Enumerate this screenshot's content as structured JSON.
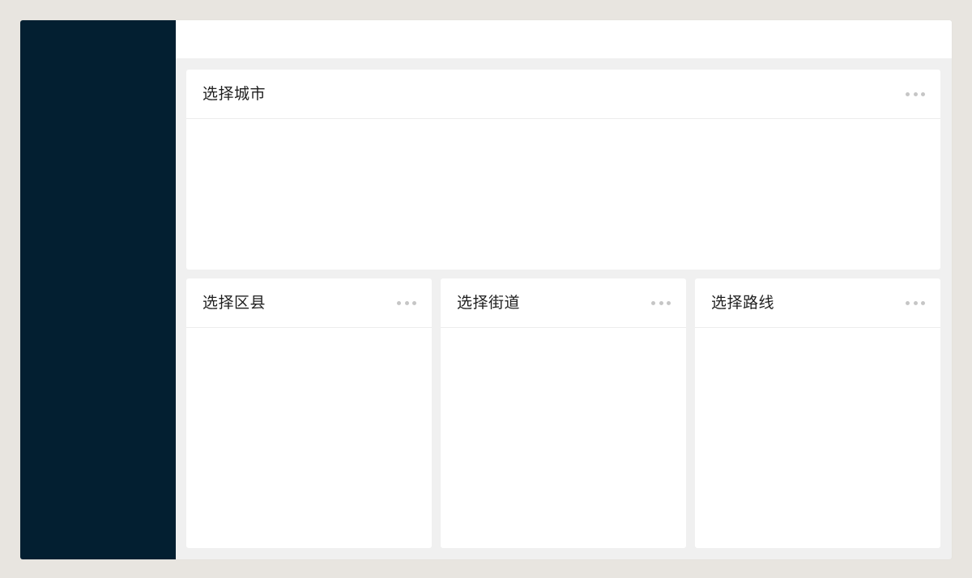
{
  "panels": {
    "city": {
      "title": "选择城市",
      "more_icon": "more-horizontal-icon"
    },
    "district": {
      "title": "选择区县",
      "more_icon": "more-horizontal-icon"
    },
    "street": {
      "title": "选择街道",
      "more_icon": "more-horizontal-icon"
    },
    "route": {
      "title": "选择路线",
      "more_icon": "more-horizontal-icon"
    }
  },
  "colors": {
    "sidebar": "#031f31",
    "content_background": "#f0f0f0",
    "panel_background": "#ffffff",
    "icon": "#c6c6c6"
  }
}
